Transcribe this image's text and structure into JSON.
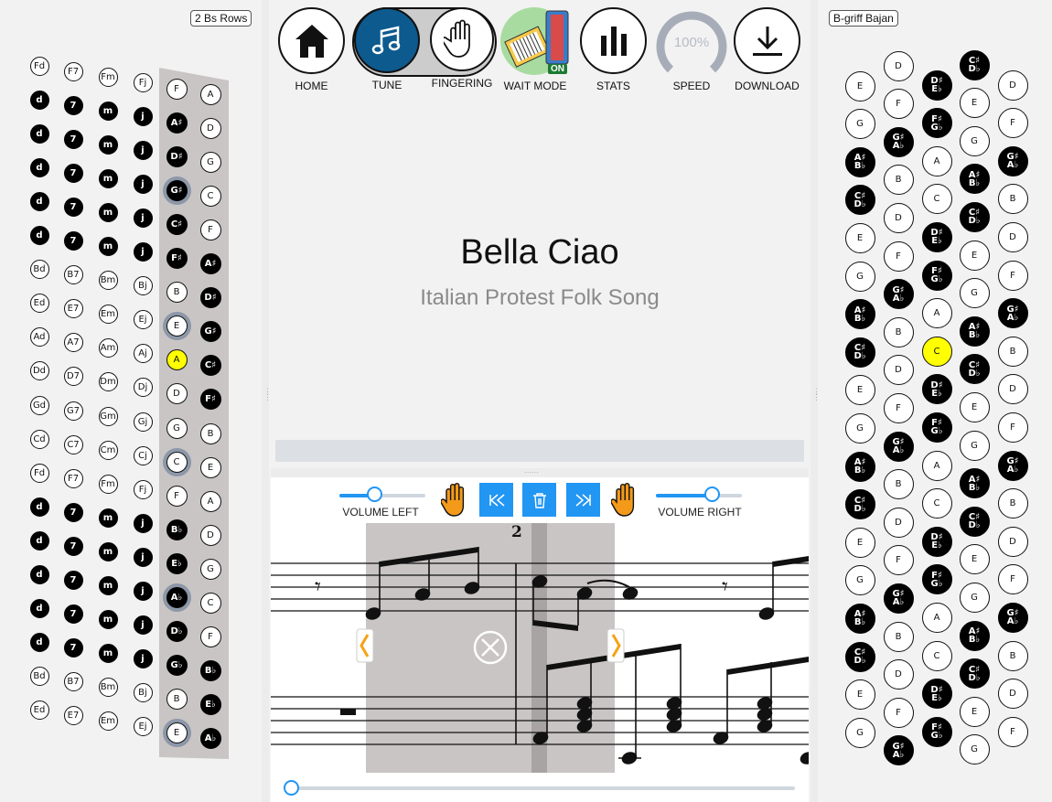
{
  "left_panel": {
    "layout_label": "2 Bs Rows",
    "bass_rows": [
      [
        "Fd",
        "d",
        "d",
        "d",
        "d",
        "d",
        "Bd",
        "Ed",
        "Ad",
        "Dd",
        "Gd",
        "Cd",
        "Fd",
        "d",
        "d",
        "d",
        "d",
        "d",
        "Bd",
        "Ed"
      ],
      [
        "F7",
        "7",
        "7",
        "7",
        "7",
        "7",
        "B7",
        "E7",
        "A7",
        "D7",
        "G7",
        "C7",
        "F7",
        "7",
        "7",
        "7",
        "7",
        "7",
        "B7",
        "E7"
      ],
      [
        "Fm",
        "m",
        "m",
        "m",
        "m",
        "m",
        "Bm",
        "Em",
        "Am",
        "Dm",
        "Gm",
        "Cm",
        "Fm",
        "m",
        "m",
        "m",
        "m",
        "m",
        "Bm",
        "Em"
      ],
      [
        "Fj",
        "j",
        "j",
        "j",
        "j",
        "j",
        "Bj",
        "Ej",
        "Aj",
        "Dj",
        "Gj",
        "Cj",
        "Fj",
        "j",
        "j",
        "j",
        "j",
        "j",
        "Bj",
        "Ej"
      ]
    ],
    "bass_row_kinds": [
      [
        "w",
        "b",
        "b",
        "b",
        "b",
        "b",
        "w",
        "w",
        "w",
        "w",
        "w",
        "w",
        "w",
        "b",
        "b",
        "b",
        "b",
        "b",
        "w",
        "w"
      ],
      [
        "w",
        "b",
        "b",
        "b",
        "b",
        "b",
        "w",
        "w",
        "w",
        "w",
        "w",
        "w",
        "w",
        "b",
        "b",
        "b",
        "b",
        "b",
        "w",
        "w"
      ],
      [
        "w",
        "b",
        "b",
        "b",
        "b",
        "b",
        "w",
        "w",
        "w",
        "w",
        "w",
        "w",
        "w",
        "b",
        "b",
        "b",
        "b",
        "b",
        "w",
        "w"
      ],
      [
        "w",
        "b",
        "b",
        "b",
        "b",
        "b",
        "w",
        "w",
        "w",
        "w",
        "w",
        "w",
        "w",
        "b",
        "b",
        "b",
        "b",
        "b",
        "w",
        "w"
      ]
    ],
    "row5": [
      "F",
      "A♯",
      "D♯",
      "G♯",
      "C♯",
      "F♯",
      "B",
      "E",
      "A",
      "D",
      "G",
      "C",
      "F",
      "B♭",
      "E♭",
      "A♭",
      "D♭",
      "G♭",
      "B",
      "E"
    ],
    "row5_kinds": [
      "w",
      "b",
      "b",
      "b-ring",
      "b",
      "b",
      "w",
      "w-ring",
      "y",
      "w",
      "w",
      "w-ring",
      "w",
      "b",
      "b",
      "b-ring",
      "b",
      "b",
      "w",
      "w-ring"
    ],
    "row6": [
      "A",
      "D",
      "G",
      "C",
      "F",
      "A♯",
      "D♯",
      "G♯",
      "C♯",
      "F♯",
      "B",
      "E",
      "A",
      "D",
      "G",
      "C",
      "F",
      "B♭",
      "E♭",
      "A♭"
    ],
    "row6_kinds": [
      "w",
      "w",
      "w",
      "w",
      "w",
      "b",
      "b",
      "b",
      "b",
      "b",
      "w",
      "w",
      "w",
      "w",
      "w",
      "w",
      "w",
      "b",
      "b",
      "b"
    ]
  },
  "toolbar": {
    "home": "HOME",
    "tune": "TUNE",
    "fingering": "FINGERING",
    "wait_mode": "WAIT MODE",
    "wait_badge": "ON",
    "stats": "STATS",
    "speed": "SPEED",
    "speed_value": "100%",
    "download": "DOWNLOAD"
  },
  "song": {
    "title": "Bella Ciao",
    "subtitle": "Italian Protest Folk Song"
  },
  "sheet_controls": {
    "volume_left_label": "VOLUME LEFT",
    "volume_right_label": "VOLUME RIGHT",
    "volume_left": 0.4,
    "volume_right": 0.65,
    "measure_number": "2",
    "playback_position": 0.0
  },
  "right_panel": {
    "layout_label": "B-griff Bajan",
    "col1": [
      "E",
      "G",
      "A♯\nB♭",
      "C♯\nD♭",
      "E",
      "G",
      "A♯\nB♭",
      "C♯\nD♭",
      "E",
      "G",
      "A♯\nB♭",
      "C♯\nD♭",
      "E",
      "G",
      "A♯\nB♭",
      "C♯\nD♭",
      "E",
      "G"
    ],
    "col1_kinds": [
      "w",
      "w",
      "b",
      "b",
      "w",
      "w",
      "b",
      "b",
      "w",
      "w",
      "b",
      "b",
      "w",
      "w",
      "b",
      "b",
      "w",
      "w"
    ],
    "col2": [
      "D",
      "F",
      "G♯\nA♭",
      "B",
      "D",
      "F",
      "G♯\nA♭",
      "B",
      "D",
      "F",
      "G♯\nA♭",
      "B",
      "D",
      "F",
      "G♯\nA♭",
      "B",
      "D",
      "F",
      "G♯\nA♭"
    ],
    "col2_kinds": [
      "w",
      "w",
      "b",
      "w",
      "w",
      "w",
      "b",
      "w",
      "w",
      "w",
      "b",
      "w",
      "w",
      "w",
      "b",
      "w",
      "w",
      "w",
      "b"
    ],
    "col3": [
      "D♯\nE♭",
      "F♯\nG♭",
      "A",
      "C",
      "D♯\nE♭",
      "F♯\nG♭",
      "A",
      "C",
      "D♯\nE♭",
      "F♯\nG♭",
      "A",
      "C",
      "D♯\nE♭",
      "F♯\nG♭",
      "A",
      "C",
      "D♯\nE♭",
      "F♯\nG♭"
    ],
    "col3_kinds": [
      "b",
      "b",
      "w",
      "w",
      "b",
      "b",
      "w",
      "y",
      "b",
      "b",
      "w",
      "w",
      "b",
      "b",
      "w",
      "w",
      "b",
      "b"
    ],
    "col4": [
      "C♯\nD♭",
      "E",
      "G",
      "A♯\nB♭",
      "C♯\nD♭",
      "E",
      "G",
      "A♯\nB♭",
      "C♯\nD♭",
      "E",
      "G",
      "A♯\nB♭",
      "C♯\nD♭",
      "E",
      "G",
      "A♯\nB♭",
      "C♯\nD♭",
      "E",
      "G"
    ],
    "col4_kinds": [
      "b",
      "w",
      "w",
      "b",
      "b",
      "w",
      "w",
      "b",
      "b",
      "w",
      "w",
      "b",
      "b",
      "w",
      "w",
      "b",
      "b",
      "w",
      "w"
    ],
    "col5": [
      "D",
      "F",
      "G♯\nA♭",
      "B",
      "D",
      "F",
      "G♯\nA♭",
      "B",
      "D",
      "F",
      "G♯\nA♭",
      "B",
      "D",
      "F",
      "G♯\nA♭",
      "B",
      "D",
      "F"
    ],
    "col5_kinds": [
      "w",
      "w",
      "b",
      "w",
      "w",
      "w",
      "b",
      "w",
      "w",
      "w",
      "b",
      "w",
      "w",
      "w",
      "b",
      "w",
      "w",
      "w"
    ]
  }
}
